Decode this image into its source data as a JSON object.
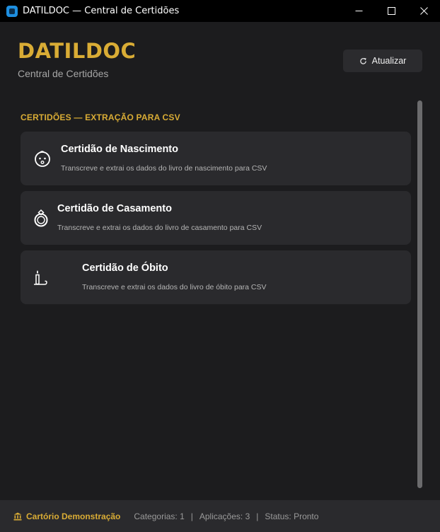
{
  "window": {
    "title": "DATILDOC — Central de Certidões"
  },
  "header": {
    "brand": "DATILDOC",
    "subtitle": "Central de Certidões",
    "refresh_label": "Atualizar"
  },
  "section": {
    "title": "CERTIDÕES — EXTRAÇÃO PARA CSV"
  },
  "cards": [
    {
      "icon": "baby-face-icon",
      "title": "Certidão de Nascimento",
      "description": "Transcreve e extrai os dados do livro de nascimento para CSV"
    },
    {
      "icon": "ring-icon",
      "title": "Certidão de Casamento",
      "description": "Transcreve e extrai os dados do livro de casamento para CSV"
    },
    {
      "icon": "candle-icon",
      "title": "Certidão de Óbito",
      "description": "Transcreve e extrai os dados do livro de óbito para CSV"
    }
  ],
  "footer": {
    "cartorio": "Cartório Demonstração",
    "categorias": "Categorias: 1",
    "aplicacoes": "Aplicações: 3",
    "status": "Status: Pronto",
    "separator": "|"
  },
  "colors": {
    "accent": "#d9ac35",
    "background": "#1c1c1e",
    "card": "#2a2a2d",
    "titlebar": "#000000"
  }
}
